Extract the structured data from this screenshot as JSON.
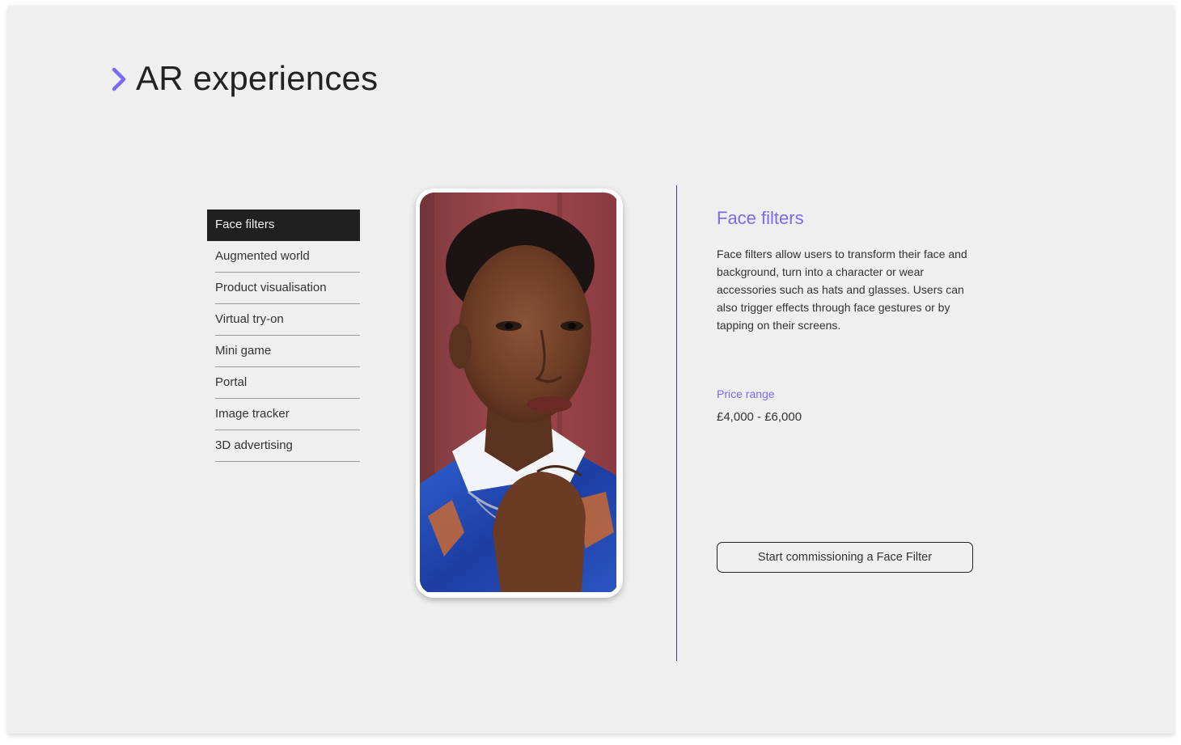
{
  "header": {
    "title": "AR experiences",
    "icon": "chevron-right-icon",
    "accent_color": "#7a6af0"
  },
  "menu": {
    "items": [
      {
        "label": "Face filters",
        "active": true
      },
      {
        "label": "Augmented world",
        "active": false
      },
      {
        "label": "Product visualisation",
        "active": false
      },
      {
        "label": "Virtual try-on",
        "active": false
      },
      {
        "label": "Mini game",
        "active": false
      },
      {
        "label": "Portal",
        "active": false
      },
      {
        "label": "Image tracker",
        "active": false
      },
      {
        "label": "3D advertising",
        "active": false
      }
    ]
  },
  "preview": {
    "image": "portrait-photo"
  },
  "detail": {
    "title": "Face filters",
    "description": "Face filters allow users to transform their face and background, turn into a character or wear accessories such as hats and glasses. Users can also trigger effects through face gestures or by tapping on their screens.",
    "price_label": "Price range",
    "price_value": "£4,000 - £6,000",
    "cta_label": "Start commissioning a Face Filter"
  }
}
